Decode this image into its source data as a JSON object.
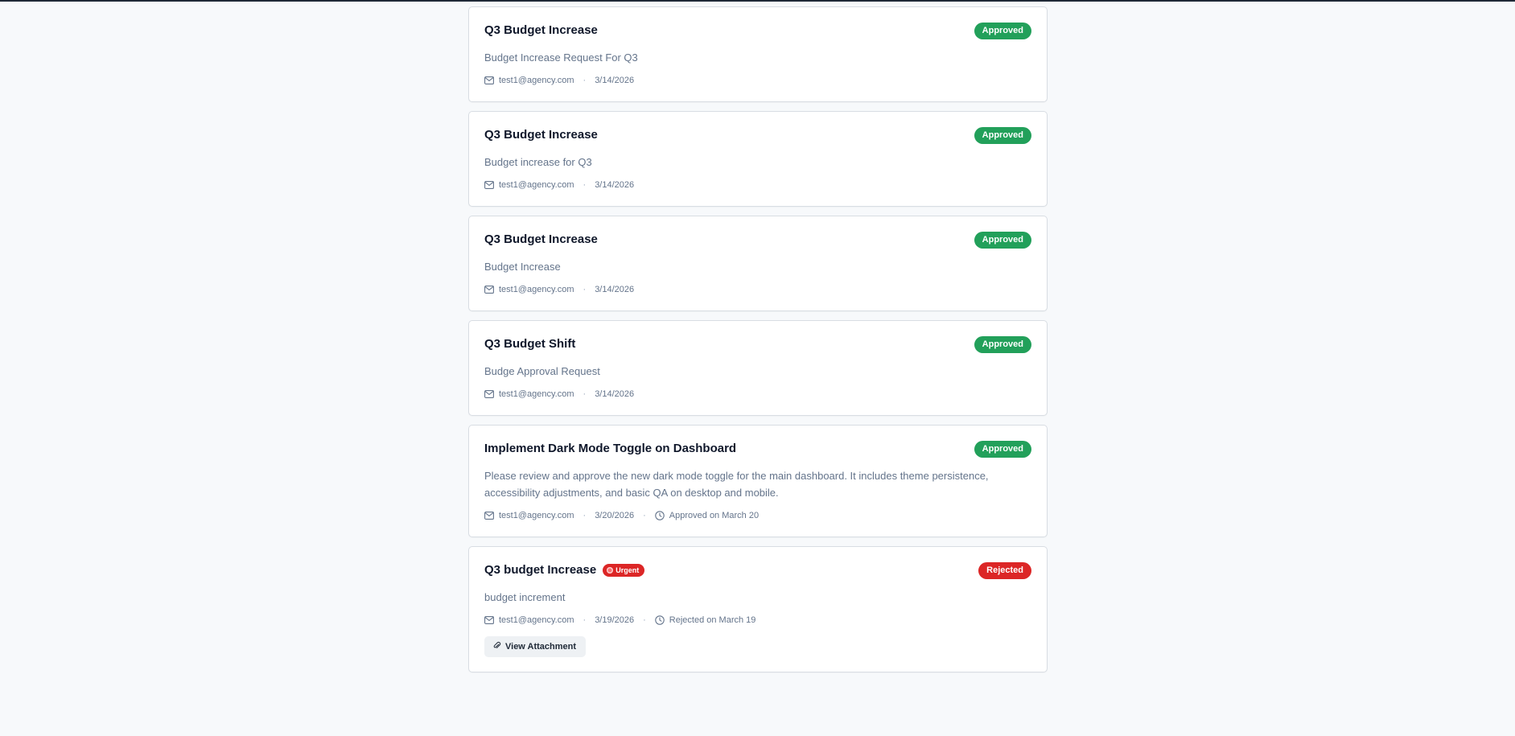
{
  "requests": [
    {
      "title": "Q3 Budget Increase",
      "description": "Budget Increase Request For Q3",
      "email": "test1@agency.com",
      "date": "3/14/2026",
      "status": "Approved"
    },
    {
      "title": "Q3 Budget Increase",
      "description": "Budget increase for Q3",
      "email": "test1@agency.com",
      "date": "3/14/2026",
      "status": "Approved"
    },
    {
      "title": "Q3 Budget Increase",
      "description": "Budget Increase",
      "email": "test1@agency.com",
      "date": "3/14/2026",
      "status": "Approved"
    },
    {
      "title": "Q3 Budget Shift",
      "description": "Budge Approval Request",
      "email": "test1@agency.com",
      "date": "3/14/2026",
      "status": "Approved"
    },
    {
      "title": "Implement Dark Mode Toggle on Dashboard",
      "description": "Please review and approve the new dark mode toggle for the main dashboard. It includes theme persistence, accessibility adjustments, and basic QA on desktop and mobile.",
      "email": "test1@agency.com",
      "date": "3/20/2026",
      "decision": "Approved on March 20",
      "status": "Approved"
    },
    {
      "title": "Q3 budget Increase",
      "urgent_label": "Urgent",
      "description": "budget increment",
      "email": "test1@agency.com",
      "date": "3/19/2026",
      "decision": "Rejected on March 19",
      "status": "Rejected",
      "attachment_label": "View Attachment"
    }
  ],
  "meta_separator": "·",
  "icons": {
    "email": "mail-icon",
    "decision": "clock-icon",
    "urgent": "urgent-dot-icon",
    "attachment": "paperclip-icon"
  },
  "colors": {
    "approved": "#22a05a",
    "rejected": "#dc2626",
    "urgent": "#dc2626"
  }
}
